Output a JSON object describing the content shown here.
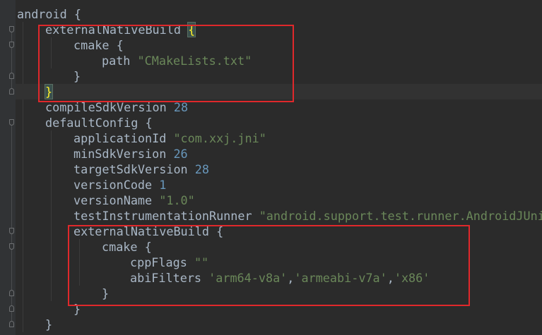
{
  "editor": {
    "lines": [
      {
        "indent": 0,
        "parts": [
          {
            "t": "android {",
            "c": "kw"
          }
        ]
      },
      {
        "indent": 1,
        "parts": [
          {
            "t": "externalNativeBuild ",
            "c": "kw"
          },
          {
            "t": "{",
            "c": "brace-hl"
          }
        ]
      },
      {
        "indent": 2,
        "parts": [
          {
            "t": "cmake {",
            "c": "kw"
          }
        ]
      },
      {
        "indent": 3,
        "parts": [
          {
            "t": "path ",
            "c": "kw"
          },
          {
            "t": "\"CMakeLists.txt\"",
            "c": "str"
          }
        ]
      },
      {
        "indent": 2,
        "parts": [
          {
            "t": "}",
            "c": "kw"
          }
        ]
      },
      {
        "indent": 1,
        "parts": [
          {
            "t": "}",
            "c": "brace-hl"
          }
        ],
        "caret": true
      },
      {
        "indent": 1,
        "parts": [
          {
            "t": "compileSdkVersion ",
            "c": "kw"
          },
          {
            "t": "28",
            "c": "num"
          }
        ]
      },
      {
        "indent": 1,
        "parts": [
          {
            "t": "defaultConfig {",
            "c": "kw"
          }
        ]
      },
      {
        "indent": 2,
        "parts": [
          {
            "t": "applicationId ",
            "c": "kw"
          },
          {
            "t": "\"com.xxj.jni\"",
            "c": "str"
          }
        ]
      },
      {
        "indent": 2,
        "parts": [
          {
            "t": "minSdkVersion ",
            "c": "kw"
          },
          {
            "t": "26",
            "c": "num"
          }
        ]
      },
      {
        "indent": 2,
        "parts": [
          {
            "t": "targetSdkVersion ",
            "c": "kw"
          },
          {
            "t": "28",
            "c": "num"
          }
        ]
      },
      {
        "indent": 2,
        "parts": [
          {
            "t": "versionCode ",
            "c": "kw"
          },
          {
            "t": "1",
            "c": "num"
          }
        ]
      },
      {
        "indent": 2,
        "parts": [
          {
            "t": "versionName ",
            "c": "kw"
          },
          {
            "t": "\"1.0\"",
            "c": "str"
          }
        ]
      },
      {
        "indent": 2,
        "parts": [
          {
            "t": "testInstrumentationRunner ",
            "c": "kw"
          },
          {
            "t": "\"android.support.test.runner.AndroidJUnitRunner\"",
            "c": "str"
          }
        ]
      },
      {
        "indent": 2,
        "parts": [
          {
            "t": "externalNativeBuild {",
            "c": "kw"
          }
        ]
      },
      {
        "indent": 3,
        "parts": [
          {
            "t": "cmake {",
            "c": "kw"
          }
        ]
      },
      {
        "indent": 4,
        "parts": [
          {
            "t": "cppFlags ",
            "c": "kw"
          },
          {
            "t": "\"\"",
            "c": "str"
          }
        ]
      },
      {
        "indent": 4,
        "parts": [
          {
            "t": "abiFilters ",
            "c": "kw"
          },
          {
            "t": "'arm64-v8a'",
            "c": "str"
          },
          {
            "t": ",",
            "c": "kw"
          },
          {
            "t": "'armeabi-v7a'",
            "c": "str"
          },
          {
            "t": ",",
            "c": "kw"
          },
          {
            "t": "'x86'",
            "c": "str"
          }
        ]
      },
      {
        "indent": 3,
        "parts": [
          {
            "t": "}",
            "c": "kw"
          }
        ]
      },
      {
        "indent": 2,
        "parts": [
          {
            "t": "}",
            "c": "kw"
          }
        ]
      },
      {
        "indent": 1,
        "parts": [
          {
            "t": "}",
            "c": "kw"
          }
        ]
      },
      {
        "indent": 1,
        "parts": [
          {
            "t": "",
            "c": "kw"
          }
        ]
      }
    ]
  },
  "colors": {
    "background": "#2b2b2b",
    "gutter": "#313335",
    "default_text": "#a9b7c6",
    "string": "#6a8759",
    "number": "#6897bb",
    "matched_brace": "#ffef28",
    "annotation_box": "#e0282b"
  },
  "icons": {
    "fold_marker": "fold-marker-icon"
  }
}
